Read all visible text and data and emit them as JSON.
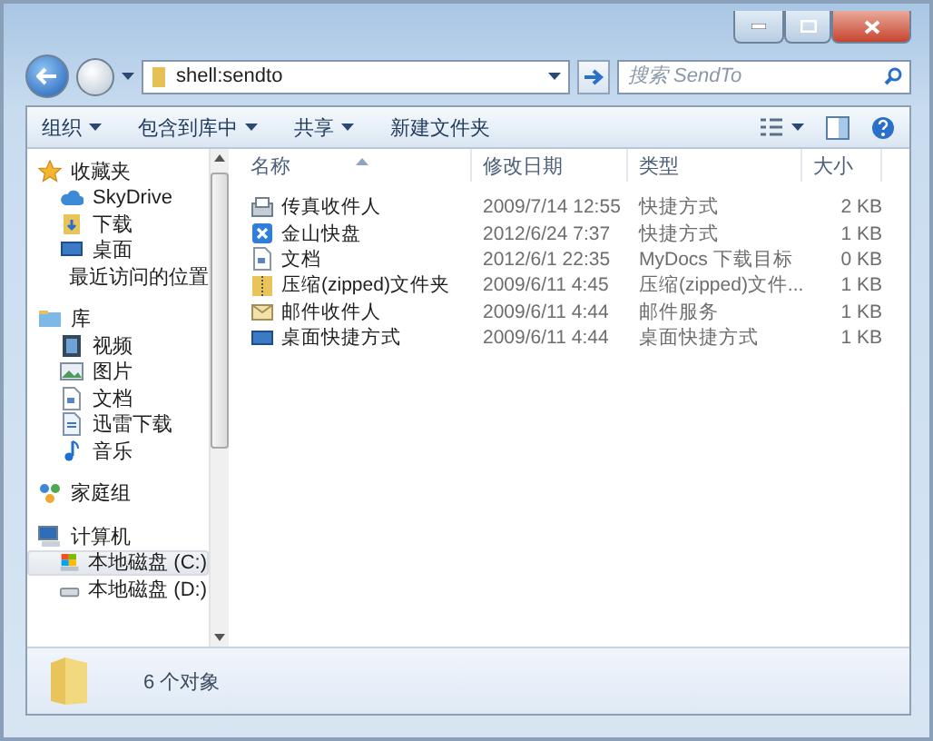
{
  "address": {
    "value": "shell:sendto"
  },
  "search": {
    "placeholder": "搜索 SendTo"
  },
  "toolbar": [
    {
      "label": "组织",
      "has_menu": true
    },
    {
      "label": "包含到库中",
      "has_menu": true
    },
    {
      "label": "共享",
      "has_menu": true
    },
    {
      "label": "新建文件夹",
      "has_menu": false
    }
  ],
  "navigation": [
    {
      "label": "收藏夹",
      "selected": false,
      "children": [
        {
          "label": "SkyDrive",
          "selected": false
        },
        {
          "label": "下载",
          "selected": false
        },
        {
          "label": "桌面",
          "selected": false
        },
        {
          "label": "最近访问的位置",
          "selected": false
        }
      ]
    },
    {
      "label": "库",
      "selected": false,
      "children": [
        {
          "label": "视频",
          "selected": false
        },
        {
          "label": "图片",
          "selected": false
        },
        {
          "label": "文档",
          "selected": false
        },
        {
          "label": "迅雷下载",
          "selected": false
        },
        {
          "label": "音乐",
          "selected": false
        }
      ]
    },
    {
      "label": "家庭组",
      "selected": false
    },
    {
      "label": "计算机",
      "selected": false,
      "children": [
        {
          "label": "本地磁盘 (C:)",
          "selected": true
        },
        {
          "label": "本地磁盘 (D:)",
          "selected": false
        }
      ]
    }
  ],
  "file_list": {
    "columns": [
      {
        "label": "名称",
        "sorted": true
      },
      {
        "label": "修改日期",
        "sorted": false
      },
      {
        "label": "类型",
        "sorted": false
      },
      {
        "label": "大小",
        "sorted": false
      }
    ],
    "rows": [
      {
        "name": "传真收件人",
        "modified": "2009/7/14 12:55",
        "type": "快捷方式",
        "size": "2 KB"
      },
      {
        "name": "金山快盘",
        "modified": "2012/6/24 7:37",
        "type": "快捷方式",
        "size": "1 KB"
      },
      {
        "name": "文档",
        "modified": "2012/6/1 22:35",
        "type": "MyDocs 下载目标",
        "size": "0 KB"
      },
      {
        "name": "压缩(zipped)文件夹",
        "modified": "2009/6/11 4:45",
        "type": "压缩(zipped)文件...",
        "size": "1 KB"
      },
      {
        "name": "邮件收件人",
        "modified": "2009/6/11 4:44",
        "type": "邮件服务",
        "size": "1 KB"
      },
      {
        "name": "桌面快捷方式",
        "modified": "2009/6/11 4:44",
        "type": "桌面快捷方式",
        "size": "1 KB"
      }
    ]
  },
  "status_bar": {
    "text": "6 个对象"
  }
}
